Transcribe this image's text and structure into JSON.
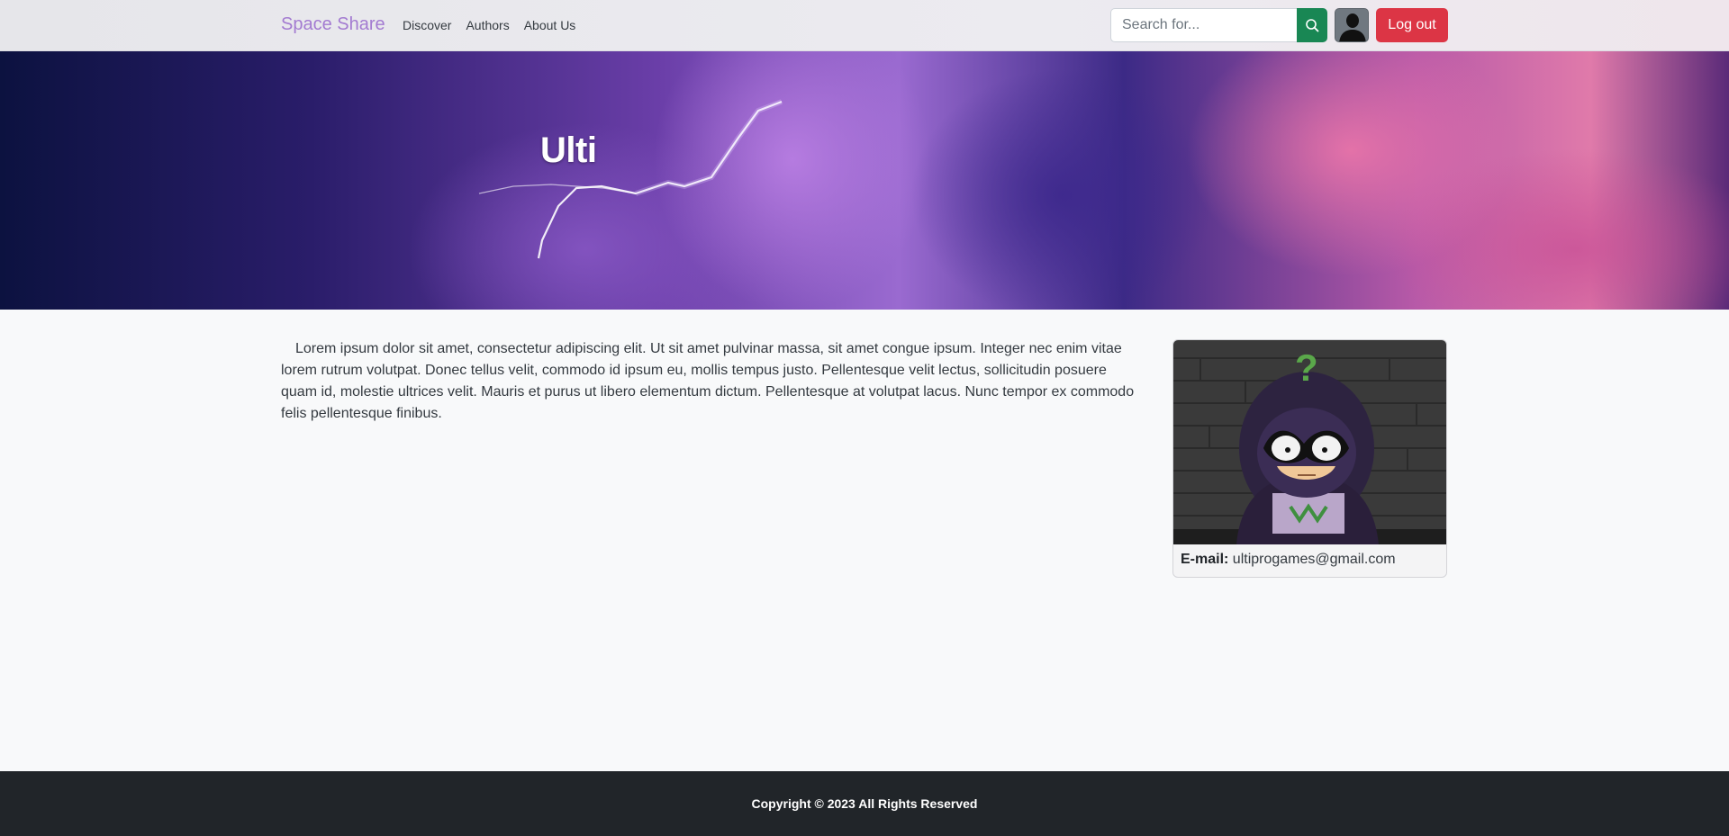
{
  "navbar": {
    "brand": "Space Share",
    "links": [
      "Discover",
      "Authors",
      "About Us"
    ],
    "search_placeholder": "Search for...",
    "logout_label": "Log out"
  },
  "hero": {
    "author_name": "Ulti"
  },
  "profile": {
    "bio": "Lorem ipsum dolor sit amet, consectetur adipiscing elit. Ut sit amet pulvinar massa, sit amet congue ipsum. Integer nec enim vitae lorem rutrum volutpat. Donec tellus velit, commodo id ipsum eu, mollis tempus justo. Pellentesque velit lectus, sollicitudin posuere quam id, molestie ultrices velit. Mauris et purus ut libero elementum dictum. Pellentesque at volutpat lacus. Nunc tempor ex commodo felis pellentesque finibus.",
    "email_label": "E-mail:",
    "email": "ultiprogames@gmail.com"
  },
  "footer": {
    "copyright": "Copyright © 2023 All Rights Reserved"
  },
  "colors": {
    "brand": "#a37bd1",
    "search_button": "#198754",
    "logout_button": "#dc3545",
    "footer_bg": "#212529"
  },
  "icons": [
    "search-icon",
    "user-avatar-icon"
  ]
}
